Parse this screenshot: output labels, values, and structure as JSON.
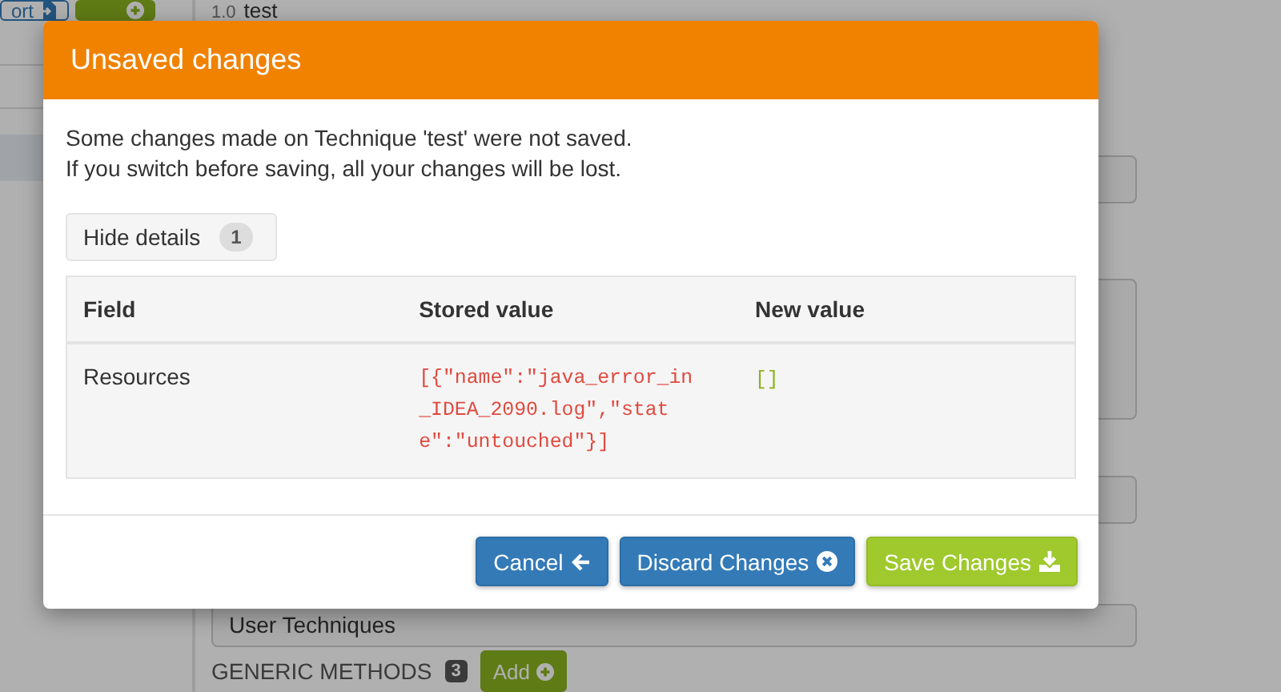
{
  "background_page": {
    "toolbar_buttons": [
      {
        "label": "ort",
        "kind": "import"
      },
      {
        "kind": "create"
      }
    ],
    "version": "1.0",
    "title": "test",
    "category_field": {
      "value": "User Techniques"
    },
    "section": {
      "title": "GENERIC METHODS",
      "count": "3",
      "add_button": "Add"
    }
  },
  "modal": {
    "title": "Unsaved changes",
    "message": [
      "Some changes made on Technique 'test' were not saved.",
      "If you switch before saving, all your changes will be lost."
    ],
    "details_toggle": {
      "label": "Hide details",
      "count": "1"
    },
    "table": {
      "columns": [
        "Field",
        "Stored value",
        "New value"
      ],
      "rows": [
        {
          "field": "Resources",
          "stored_value": "[{\"name\":\"java_error_in_IDEA_2090.log\",\"state\":\"untouched\"}]",
          "new_value": "[]"
        }
      ]
    },
    "buttons": [
      {
        "label": "Cancel",
        "kind": "cancel"
      },
      {
        "label": "Discard Changes",
        "kind": "discard"
      },
      {
        "label": "Save Changes",
        "kind": "save"
      }
    ]
  }
}
